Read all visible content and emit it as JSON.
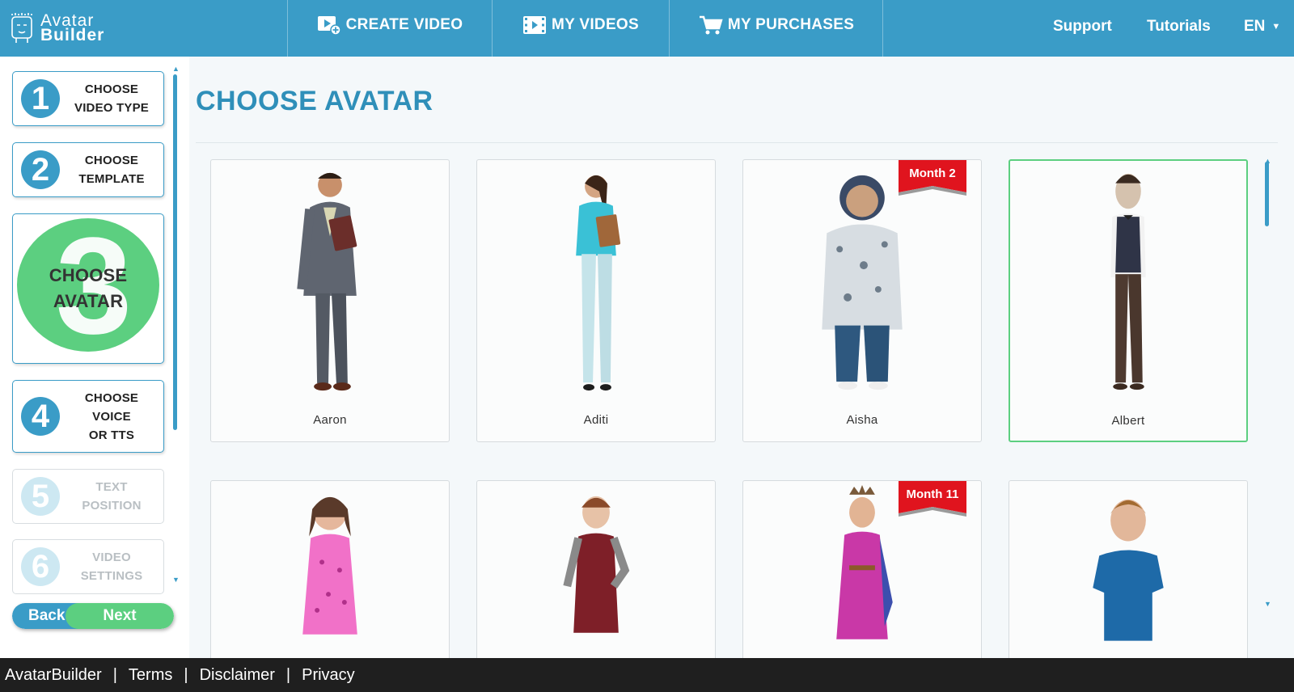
{
  "header": {
    "logo_line1": "Avatar",
    "logo_line2": "Builder",
    "nav": [
      {
        "label": "CREATE VIDEO",
        "icon": "video-plus-icon"
      },
      {
        "label": "MY VIDEOS",
        "icon": "film-icon"
      },
      {
        "label": "MY PURCHASES",
        "icon": "cart-icon"
      }
    ],
    "support": "Support",
    "tutorials": "Tutorials",
    "language": "EN"
  },
  "steps": [
    {
      "num": "1",
      "line1": "CHOOSE",
      "line2": "VIDEO TYPE",
      "line3": "",
      "state": "done"
    },
    {
      "num": "2",
      "line1": "CHOOSE",
      "line2": "TEMPLATE",
      "line3": "",
      "state": "done"
    },
    {
      "num": "3",
      "line1": "CHOOSE",
      "line2": "AVATAR",
      "line3": "",
      "state": "active"
    },
    {
      "num": "4",
      "line1": "CHOOSE",
      "line2": "VOICE",
      "line3": "OR TTS",
      "state": "done"
    },
    {
      "num": "5",
      "line1": "TEXT",
      "line2": "POSITION",
      "line3": "",
      "state": "disabled"
    },
    {
      "num": "6",
      "line1": "VIDEO",
      "line2": "SETTINGS",
      "line3": "",
      "state": "disabled"
    }
  ],
  "buttons": {
    "back": "Back",
    "next": "Next"
  },
  "main": {
    "title": "CHOOSE AVATAR",
    "avatars": [
      {
        "name": "Aaron",
        "badge": ""
      },
      {
        "name": "Aditi",
        "badge": ""
      },
      {
        "name": "Aisha",
        "badge": "Month 2"
      },
      {
        "name": "Albert",
        "badge": "",
        "selected": true
      },
      {
        "name": "",
        "badge": ""
      },
      {
        "name": "",
        "badge": ""
      },
      {
        "name": "",
        "badge": "Month 11"
      },
      {
        "name": "",
        "badge": ""
      }
    ]
  },
  "footer": {
    "brand": "AvatarBuilder",
    "terms": "Terms",
    "disclaimer": "Disclaimer",
    "privacy": "Privacy",
    "separator": "|"
  },
  "colors": {
    "brand_blue": "#3a9cc7",
    "active_green": "#5ccf80",
    "ribbon_red": "#e0141e",
    "footer_bg": "#1f1f1f"
  }
}
